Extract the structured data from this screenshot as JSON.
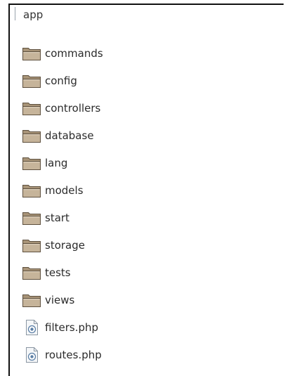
{
  "root": {
    "label": "app"
  },
  "tree": {
    "items": [
      {
        "label": "commands",
        "type": "folder",
        "icon": "folder-icon"
      },
      {
        "label": "config",
        "type": "folder",
        "icon": "folder-icon"
      },
      {
        "label": "controllers",
        "type": "folder",
        "icon": "folder-icon"
      },
      {
        "label": "database",
        "type": "folder",
        "icon": "folder-icon"
      },
      {
        "label": "lang",
        "type": "folder",
        "icon": "folder-icon"
      },
      {
        "label": "models",
        "type": "folder",
        "icon": "folder-icon"
      },
      {
        "label": "start",
        "type": "folder",
        "icon": "folder-icon"
      },
      {
        "label": "storage",
        "type": "folder",
        "icon": "folder-icon"
      },
      {
        "label": "tests",
        "type": "folder",
        "icon": "folder-icon"
      },
      {
        "label": "views",
        "type": "folder",
        "icon": "folder-icon"
      },
      {
        "label": "filters.php",
        "type": "file",
        "icon": "php-file-icon"
      },
      {
        "label": "routes.php",
        "type": "file",
        "icon": "php-file-icon"
      }
    ]
  },
  "colors": {
    "folder_body": "#a89478",
    "folder_front": "#c6b49a",
    "folder_edge": "#5e503e",
    "file_page": "#f4f6f8",
    "file_edge": "#8b97a3",
    "file_badge": "#5b7fa6"
  }
}
